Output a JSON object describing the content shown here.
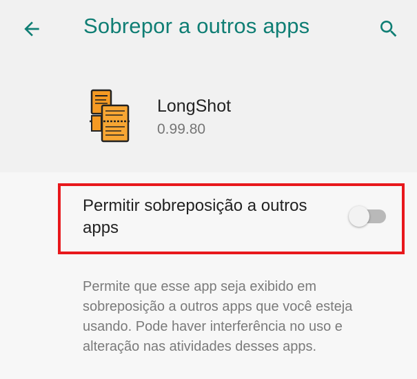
{
  "header": {
    "title": "Sobrepor a outros apps",
    "back_icon": "arrow-back-icon",
    "search_icon": "search-icon",
    "accent_color": "#0f7e74"
  },
  "app": {
    "name": "LongShot",
    "version": "0.99.80",
    "icon": "longshot-app-icon"
  },
  "setting": {
    "label": "Permitir sobreposição a outros apps",
    "enabled": false,
    "highlight_color": "#e8181c"
  },
  "description": "Permite que esse app seja exibido em sobreposição a outros apps que você esteja usando. Pode haver interferência no uso e alteração nas atividades desses apps."
}
